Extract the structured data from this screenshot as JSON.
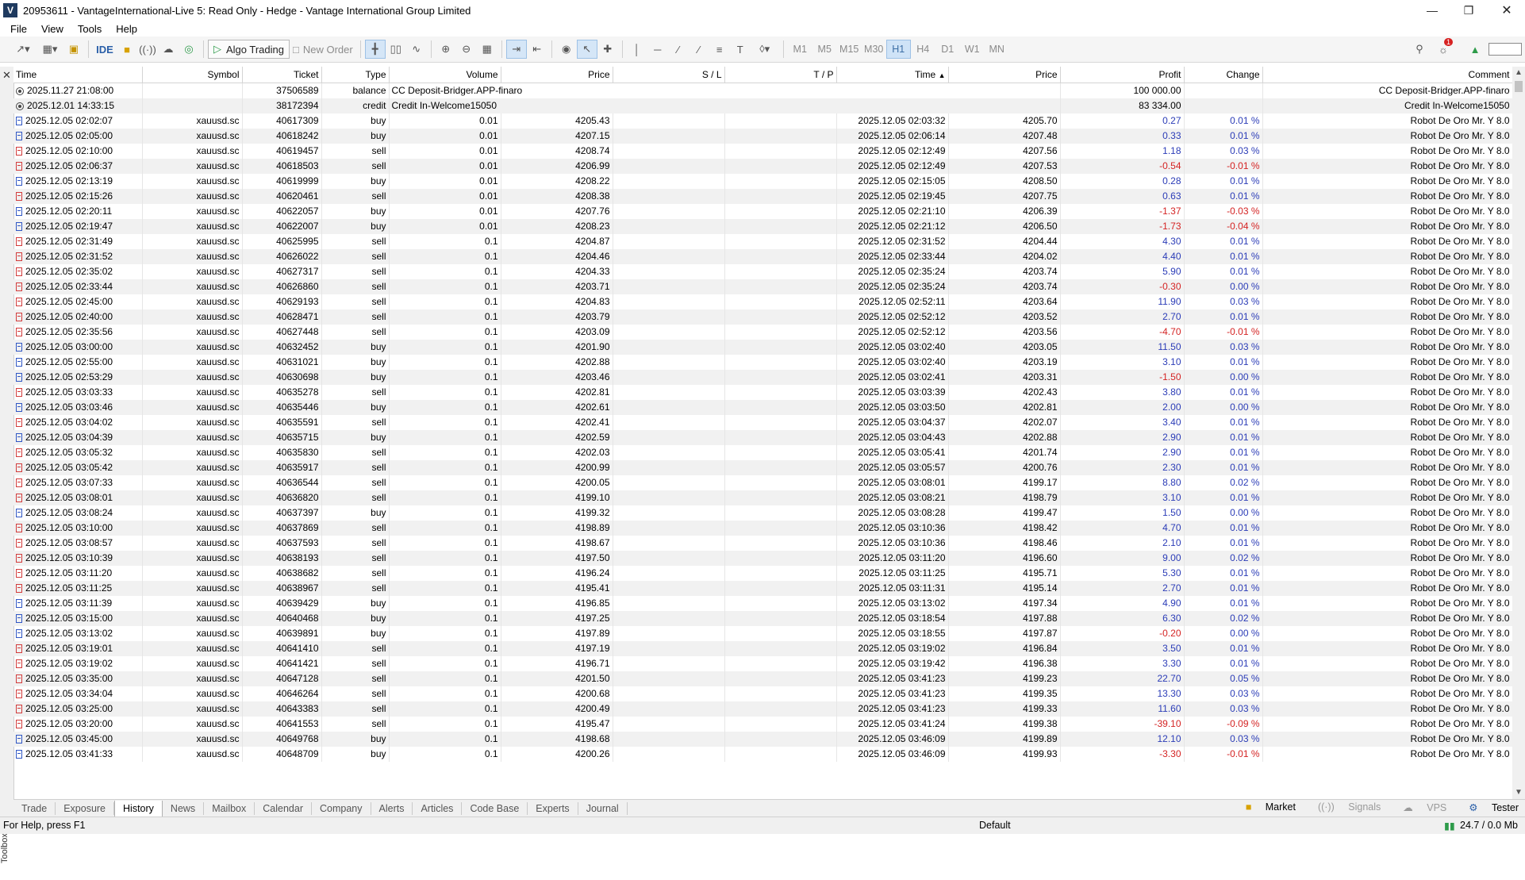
{
  "window": {
    "title": "20953611 - VantageInternational-Live 5: Read Only - Hedge - Vantage International Group Limited"
  },
  "menu": [
    "File",
    "View",
    "Tools",
    "Help"
  ],
  "toolbar": {
    "ide_label": "IDE",
    "algo_trading_label": "Algo Trading",
    "new_order_label": "New Order",
    "timeframes": [
      "M1",
      "M5",
      "M15",
      "M30",
      "H1",
      "H4",
      "D1",
      "W1",
      "MN"
    ],
    "active_timeframe": "H1",
    "notification_count": "1"
  },
  "columns": [
    "Time",
    "Symbol",
    "Ticket",
    "Type",
    "Volume",
    "Price",
    "S / L",
    "T / P",
    "Time",
    "Price",
    "Profit",
    "Change",
    "Comment"
  ],
  "balance_rows": [
    {
      "time": "2025.11.27 21:08:00",
      "ticket": "37506589",
      "type": "balance",
      "note": "CC Deposit-Bridger.APP-finaro",
      "profit": "100 000.00",
      "comment": "CC Deposit-Bridger.APP-finaro"
    },
    {
      "time": "2025.12.01 14:33:15",
      "ticket": "38172394",
      "type": "credit",
      "note": "Credit In-Welcome15050",
      "profit": "83 334.00",
      "comment": "Credit In-Welcome15050"
    }
  ],
  "trades": [
    [
      "2025.12.05 02:02:07",
      "xauusd.sc",
      "40617309",
      "buy",
      "0.01",
      "4205.43",
      "2025.12.05 02:03:32",
      "4205.70",
      "0.27",
      "0.01 %"
    ],
    [
      "2025.12.05 02:05:00",
      "xauusd.sc",
      "40618242",
      "buy",
      "0.01",
      "4207.15",
      "2025.12.05 02:06:14",
      "4207.48",
      "0.33",
      "0.01 %"
    ],
    [
      "2025.12.05 02:10:00",
      "xauusd.sc",
      "40619457",
      "sell",
      "0.01",
      "4208.74",
      "2025.12.05 02:12:49",
      "4207.56",
      "1.18",
      "0.03 %"
    ],
    [
      "2025.12.05 02:06:37",
      "xauusd.sc",
      "40618503",
      "sell",
      "0.01",
      "4206.99",
      "2025.12.05 02:12:49",
      "4207.53",
      "-0.54",
      "-0.01 %"
    ],
    [
      "2025.12.05 02:13:19",
      "xauusd.sc",
      "40619999",
      "buy",
      "0.01",
      "4208.22",
      "2025.12.05 02:15:05",
      "4208.50",
      "0.28",
      "0.01 %"
    ],
    [
      "2025.12.05 02:15:26",
      "xauusd.sc",
      "40620461",
      "sell",
      "0.01",
      "4208.38",
      "2025.12.05 02:19:45",
      "4207.75",
      "0.63",
      "0.01 %"
    ],
    [
      "2025.12.05 02:20:11",
      "xauusd.sc",
      "40622057",
      "buy",
      "0.01",
      "4207.76",
      "2025.12.05 02:21:10",
      "4206.39",
      "-1.37",
      "-0.03 %"
    ],
    [
      "2025.12.05 02:19:47",
      "xauusd.sc",
      "40622007",
      "buy",
      "0.01",
      "4208.23",
      "2025.12.05 02:21:12",
      "4206.50",
      "-1.73",
      "-0.04 %"
    ],
    [
      "2025.12.05 02:31:49",
      "xauusd.sc",
      "40625995",
      "sell",
      "0.1",
      "4204.87",
      "2025.12.05 02:31:52",
      "4204.44",
      "4.30",
      "0.01 %"
    ],
    [
      "2025.12.05 02:31:52",
      "xauusd.sc",
      "40626022",
      "sell",
      "0.1",
      "4204.46",
      "2025.12.05 02:33:44",
      "4204.02",
      "4.40",
      "0.01 %"
    ],
    [
      "2025.12.05 02:35:02",
      "xauusd.sc",
      "40627317",
      "sell",
      "0.1",
      "4204.33",
      "2025.12.05 02:35:24",
      "4203.74",
      "5.90",
      "0.01 %"
    ],
    [
      "2025.12.05 02:33:44",
      "xauusd.sc",
      "40626860",
      "sell",
      "0.1",
      "4203.71",
      "2025.12.05 02:35:24",
      "4203.74",
      "-0.30",
      "0.00 %"
    ],
    [
      "2025.12.05 02:45:00",
      "xauusd.sc",
      "40629193",
      "sell",
      "0.1",
      "4204.83",
      "2025.12.05 02:52:11",
      "4203.64",
      "11.90",
      "0.03 %"
    ],
    [
      "2025.12.05 02:40:00",
      "xauusd.sc",
      "40628471",
      "sell",
      "0.1",
      "4203.79",
      "2025.12.05 02:52:12",
      "4203.52",
      "2.70",
      "0.01 %"
    ],
    [
      "2025.12.05 02:35:56",
      "xauusd.sc",
      "40627448",
      "sell",
      "0.1",
      "4203.09",
      "2025.12.05 02:52:12",
      "4203.56",
      "-4.70",
      "-0.01 %"
    ],
    [
      "2025.12.05 03:00:00",
      "xauusd.sc",
      "40632452",
      "buy",
      "0.1",
      "4201.90",
      "2025.12.05 03:02:40",
      "4203.05",
      "11.50",
      "0.03 %"
    ],
    [
      "2025.12.05 02:55:00",
      "xauusd.sc",
      "40631021",
      "buy",
      "0.1",
      "4202.88",
      "2025.12.05 03:02:40",
      "4203.19",
      "3.10",
      "0.01 %"
    ],
    [
      "2025.12.05 02:53:29",
      "xauusd.sc",
      "40630698",
      "buy",
      "0.1",
      "4203.46",
      "2025.12.05 03:02:41",
      "4203.31",
      "-1.50",
      "0.00 %"
    ],
    [
      "2025.12.05 03:03:33",
      "xauusd.sc",
      "40635278",
      "sell",
      "0.1",
      "4202.81",
      "2025.12.05 03:03:39",
      "4202.43",
      "3.80",
      "0.01 %"
    ],
    [
      "2025.12.05 03:03:46",
      "xauusd.sc",
      "40635446",
      "buy",
      "0.1",
      "4202.61",
      "2025.12.05 03:03:50",
      "4202.81",
      "2.00",
      "0.00 %"
    ],
    [
      "2025.12.05 03:04:02",
      "xauusd.sc",
      "40635591",
      "sell",
      "0.1",
      "4202.41",
      "2025.12.05 03:04:37",
      "4202.07",
      "3.40",
      "0.01 %"
    ],
    [
      "2025.12.05 03:04:39",
      "xauusd.sc",
      "40635715",
      "buy",
      "0.1",
      "4202.59",
      "2025.12.05 03:04:43",
      "4202.88",
      "2.90",
      "0.01 %"
    ],
    [
      "2025.12.05 03:05:32",
      "xauusd.sc",
      "40635830",
      "sell",
      "0.1",
      "4202.03",
      "2025.12.05 03:05:41",
      "4201.74",
      "2.90",
      "0.01 %"
    ],
    [
      "2025.12.05 03:05:42",
      "xauusd.sc",
      "40635917",
      "sell",
      "0.1",
      "4200.99",
      "2025.12.05 03:05:57",
      "4200.76",
      "2.30",
      "0.01 %"
    ],
    [
      "2025.12.05 03:07:33",
      "xauusd.sc",
      "40636544",
      "sell",
      "0.1",
      "4200.05",
      "2025.12.05 03:08:01",
      "4199.17",
      "8.80",
      "0.02 %"
    ],
    [
      "2025.12.05 03:08:01",
      "xauusd.sc",
      "40636820",
      "sell",
      "0.1",
      "4199.10",
      "2025.12.05 03:08:21",
      "4198.79",
      "3.10",
      "0.01 %"
    ],
    [
      "2025.12.05 03:08:24",
      "xauusd.sc",
      "40637397",
      "buy",
      "0.1",
      "4199.32",
      "2025.12.05 03:08:28",
      "4199.47",
      "1.50",
      "0.00 %"
    ],
    [
      "2025.12.05 03:10:00",
      "xauusd.sc",
      "40637869",
      "sell",
      "0.1",
      "4198.89",
      "2025.12.05 03:10:36",
      "4198.42",
      "4.70",
      "0.01 %"
    ],
    [
      "2025.12.05 03:08:57",
      "xauusd.sc",
      "40637593",
      "sell",
      "0.1",
      "4198.67",
      "2025.12.05 03:10:36",
      "4198.46",
      "2.10",
      "0.01 %"
    ],
    [
      "2025.12.05 03:10:39",
      "xauusd.sc",
      "40638193",
      "sell",
      "0.1",
      "4197.50",
      "2025.12.05 03:11:20",
      "4196.60",
      "9.00",
      "0.02 %"
    ],
    [
      "2025.12.05 03:11:20",
      "xauusd.sc",
      "40638682",
      "sell",
      "0.1",
      "4196.24",
      "2025.12.05 03:11:25",
      "4195.71",
      "5.30",
      "0.01 %"
    ],
    [
      "2025.12.05 03:11:25",
      "xauusd.sc",
      "40638967",
      "sell",
      "0.1",
      "4195.41",
      "2025.12.05 03:11:31",
      "4195.14",
      "2.70",
      "0.01 %"
    ],
    [
      "2025.12.05 03:11:39",
      "xauusd.sc",
      "40639429",
      "buy",
      "0.1",
      "4196.85",
      "2025.12.05 03:13:02",
      "4197.34",
      "4.90",
      "0.01 %"
    ],
    [
      "2025.12.05 03:15:00",
      "xauusd.sc",
      "40640468",
      "buy",
      "0.1",
      "4197.25",
      "2025.12.05 03:18:54",
      "4197.88",
      "6.30",
      "0.02 %"
    ],
    [
      "2025.12.05 03:13:02",
      "xauusd.sc",
      "40639891",
      "buy",
      "0.1",
      "4197.89",
      "2025.12.05 03:18:55",
      "4197.87",
      "-0.20",
      "0.00 %"
    ],
    [
      "2025.12.05 03:19:01",
      "xauusd.sc",
      "40641410",
      "sell",
      "0.1",
      "4197.19",
      "2025.12.05 03:19:02",
      "4196.84",
      "3.50",
      "0.01 %"
    ],
    [
      "2025.12.05 03:19:02",
      "xauusd.sc",
      "40641421",
      "sell",
      "0.1",
      "4196.71",
      "2025.12.05 03:19:42",
      "4196.38",
      "3.30",
      "0.01 %"
    ],
    [
      "2025.12.05 03:35:00",
      "xauusd.sc",
      "40647128",
      "sell",
      "0.1",
      "4201.50",
      "2025.12.05 03:41:23",
      "4199.23",
      "22.70",
      "0.05 %"
    ],
    [
      "2025.12.05 03:34:04",
      "xauusd.sc",
      "40646264",
      "sell",
      "0.1",
      "4200.68",
      "2025.12.05 03:41:23",
      "4199.35",
      "13.30",
      "0.03 %"
    ],
    [
      "2025.12.05 03:25:00",
      "xauusd.sc",
      "40643383",
      "sell",
      "0.1",
      "4200.49",
      "2025.12.05 03:41:23",
      "4199.33",
      "11.60",
      "0.03 %"
    ],
    [
      "2025.12.05 03:20:00",
      "xauusd.sc",
      "40641553",
      "sell",
      "0.1",
      "4195.47",
      "2025.12.05 03:41:24",
      "4199.38",
      "-39.10",
      "-0.09 %"
    ],
    [
      "2025.12.05 03:45:00",
      "xauusd.sc",
      "40649768",
      "buy",
      "0.1",
      "4198.68",
      "2025.12.05 03:46:09",
      "4199.89",
      "12.10",
      "0.03 %"
    ],
    [
      "2025.12.05 03:41:33",
      "xauusd.sc",
      "40648709",
      "buy",
      "0.1",
      "4200.26",
      "2025.12.05 03:46:09",
      "4199.93",
      "-3.30",
      "-0.01 %"
    ]
  ],
  "trade_comment": "Robot De Oro Mr. Y 8.0",
  "bottom_tabs": [
    "Trade",
    "Exposure",
    "History",
    "News",
    "Mailbox",
    "Calendar",
    "Company",
    "Alerts",
    "Articles",
    "Code Base",
    "Experts",
    "Journal"
  ],
  "active_tab": "History",
  "bottom_right": {
    "market": "Market",
    "signals": "Signals",
    "vps": "VPS",
    "tester": "Tester"
  },
  "toolbox_label": "Toolbox",
  "status": {
    "help": "For Help, press F1",
    "profile": "Default",
    "traffic": "24.7 / 0.0 Mb"
  }
}
